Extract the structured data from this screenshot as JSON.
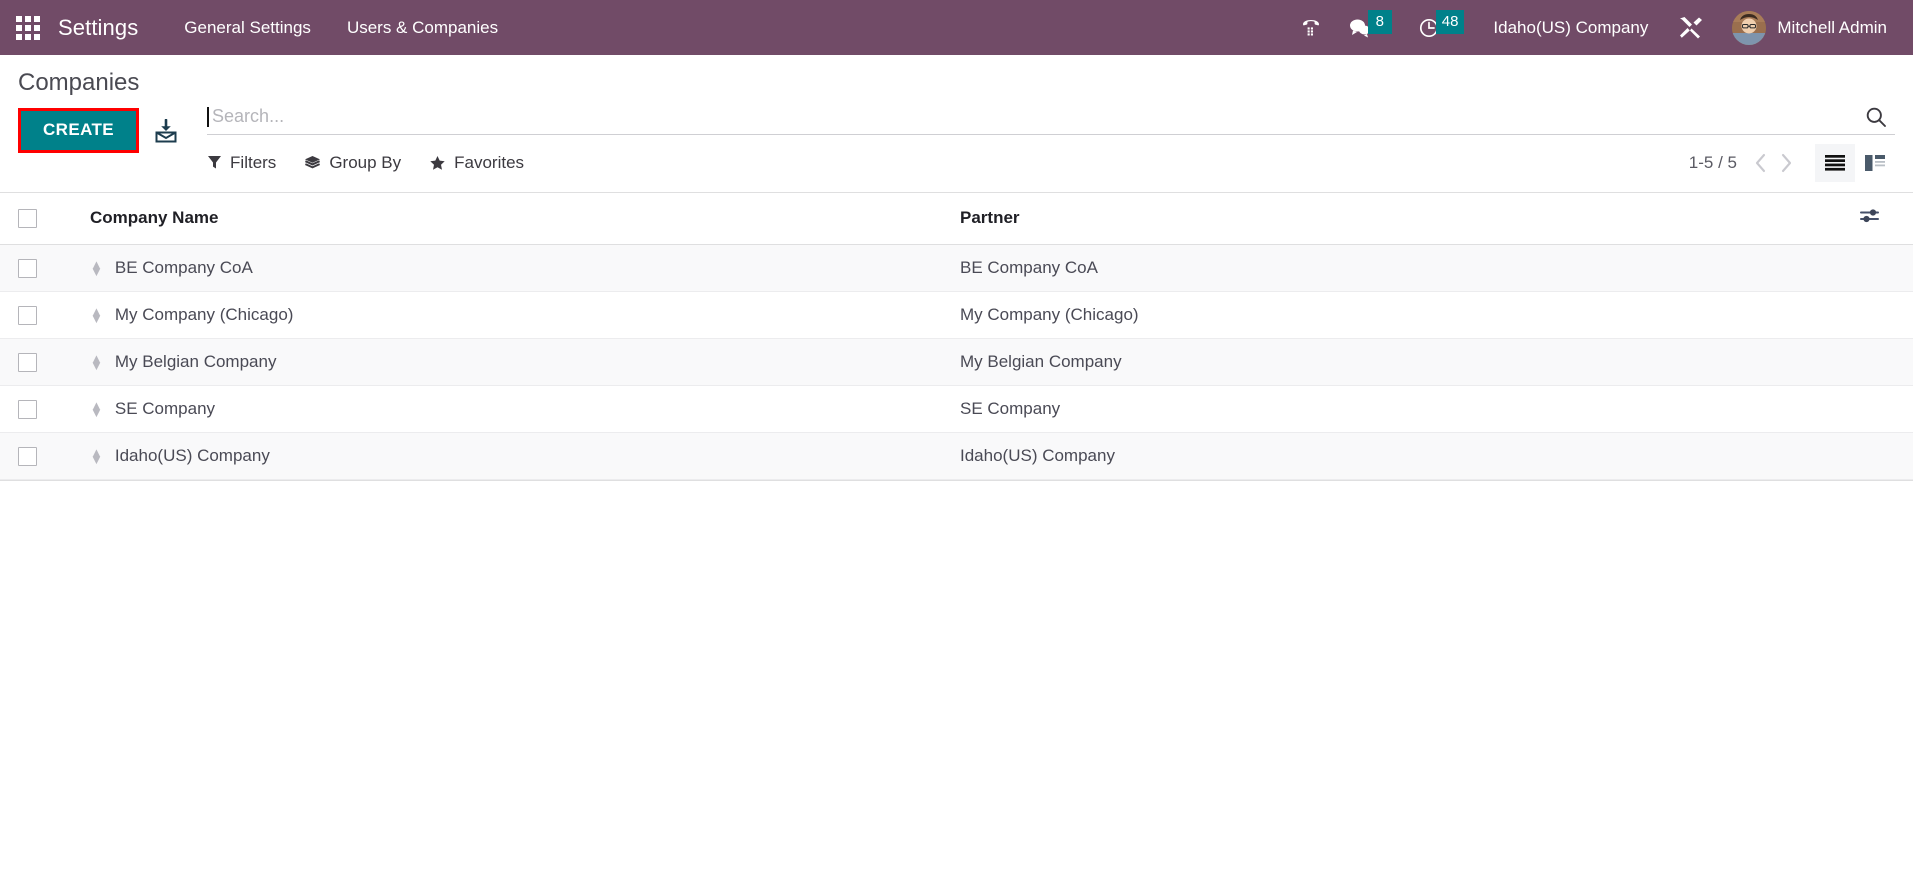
{
  "navbar": {
    "apps_icon": "apps-grid-icon",
    "app_name": "Settings",
    "menus": [
      {
        "label": "General Settings"
      },
      {
        "label": "Users & Companies"
      }
    ],
    "systray": [
      {
        "icon": "voip-phone-icon",
        "badge": null
      },
      {
        "icon": "messaging-chat-icon",
        "badge": "8"
      },
      {
        "icon": "activities-clock-icon",
        "badge": "48"
      }
    ],
    "company": "Idaho(US) Company",
    "debug_icon": "tools-wrench-icon",
    "user_name": "Mitchell Admin",
    "avatar_icon": "user-avatar",
    "bg_color": "#714B67",
    "badge_color": "#00818A"
  },
  "control_panel": {
    "breadcrumb": "Companies",
    "create_label": "CREATE",
    "create_color": "#00818A",
    "create_highlight_color": "#ff0000",
    "import_icon": "import-records-icon",
    "search": {
      "value": "",
      "placeholder": "Search...",
      "submit_icon": "search-icon"
    },
    "dropdowns": [
      {
        "label": "Filters",
        "icon": "filter-funnel-icon"
      },
      {
        "label": "Group By",
        "icon": "layers-group-icon"
      },
      {
        "label": "Favorites",
        "icon": "star-icon"
      }
    ],
    "pager": {
      "value": "1-5 / 5",
      "previous_icon": "chevron-left-icon",
      "next_icon": "chevron-right-icon"
    },
    "view_switcher": [
      {
        "icon": "list-view-icon",
        "active": true
      },
      {
        "icon": "kanban-view-icon",
        "active": false
      }
    ]
  },
  "list_view": {
    "select_all_checkbox": false,
    "columns": [
      {
        "label": "Company Name"
      },
      {
        "label": "Partner"
      }
    ],
    "optional_columns_icon": "column-options-sliders-icon",
    "rows": [
      {
        "checked": false,
        "handle": "drag-handle-icon",
        "company_name": "BE Company CoA",
        "partner": "BE Company CoA"
      },
      {
        "checked": false,
        "handle": "drag-handle-icon",
        "company_name": "My Company (Chicago)",
        "partner": "My Company (Chicago)"
      },
      {
        "checked": false,
        "handle": "drag-handle-icon",
        "company_name": "My Belgian Company",
        "partner": "My Belgian Company"
      },
      {
        "checked": false,
        "handle": "drag-handle-icon",
        "company_name": "SE Company",
        "partner": "SE Company"
      },
      {
        "checked": false,
        "handle": "drag-handle-icon",
        "company_name": "Idaho(US) Company",
        "partner": "Idaho(US) Company"
      }
    ]
  }
}
